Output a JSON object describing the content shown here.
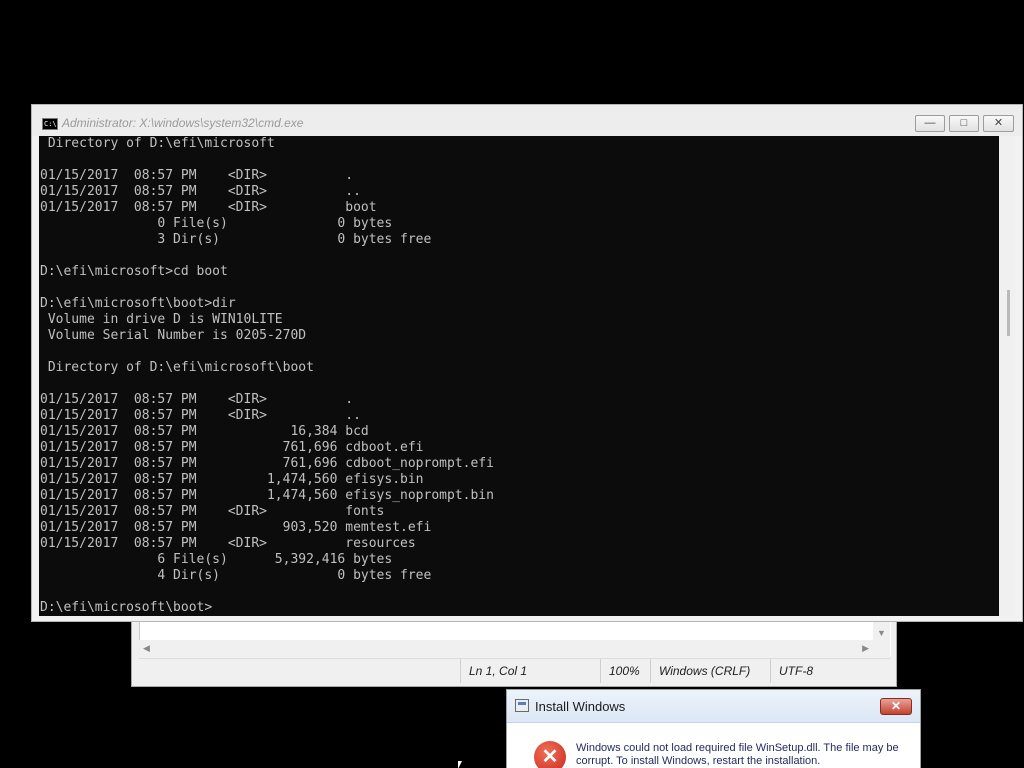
{
  "notepad": {
    "status": {
      "position": "Ln 1, Col 1",
      "zoom": "100%",
      "line_ending": "Windows (CRLF)",
      "encoding": "UTF-8"
    }
  },
  "cmd": {
    "title": "Administrator: X:\\windows\\system32\\cmd.exe",
    "icon_text": "C:\\",
    "controls": {
      "minimize": "—",
      "maximize": "□",
      "close": "✕"
    },
    "lines": [
      " Directory of D:\\efi\\microsoft",
      "",
      "01/15/2017  08:57 PM    <DIR>          .",
      "01/15/2017  08:57 PM    <DIR>          ..",
      "01/15/2017  08:57 PM    <DIR>          boot",
      "               0 File(s)              0 bytes",
      "               3 Dir(s)               0 bytes free",
      "",
      "D:\\efi\\microsoft>cd boot",
      "",
      "D:\\efi\\microsoft\\boot>dir",
      " Volume in drive D is WIN10LITE",
      " Volume Serial Number is 0205-270D",
      "",
      " Directory of D:\\efi\\microsoft\\boot",
      "",
      "01/15/2017  08:57 PM    <DIR>          .",
      "01/15/2017  08:57 PM    <DIR>          ..",
      "01/15/2017  08:57 PM            16,384 bcd",
      "01/15/2017  08:57 PM           761,696 cdboot.efi",
      "01/15/2017  08:57 PM           761,696 cdboot_noprompt.efi",
      "01/15/2017  08:57 PM         1,474,560 efisys.bin",
      "01/15/2017  08:57 PM         1,474,560 efisys_noprompt.bin",
      "01/15/2017  08:57 PM    <DIR>          fonts",
      "01/15/2017  08:57 PM           903,520 memtest.efi",
      "01/15/2017  08:57 PM    <DIR>          resources",
      "               6 File(s)      5,392,416 bytes",
      "               4 Dir(s)               0 bytes free",
      "",
      "D:\\efi\\microsoft\\boot>"
    ]
  },
  "dialog": {
    "title": "Install Windows",
    "close_label": "✕",
    "error_glyph": "✕",
    "message": "Windows could not load required file WinSetup.dll. The file may be corrupt. To install Windows, restart the installation."
  },
  "colors": {
    "desktop": "#000000",
    "console_bg": "#0c0c0c",
    "console_text": "#c0c0c0",
    "dialog_close": "#c4412f",
    "error_icon": "#d9321f"
  }
}
